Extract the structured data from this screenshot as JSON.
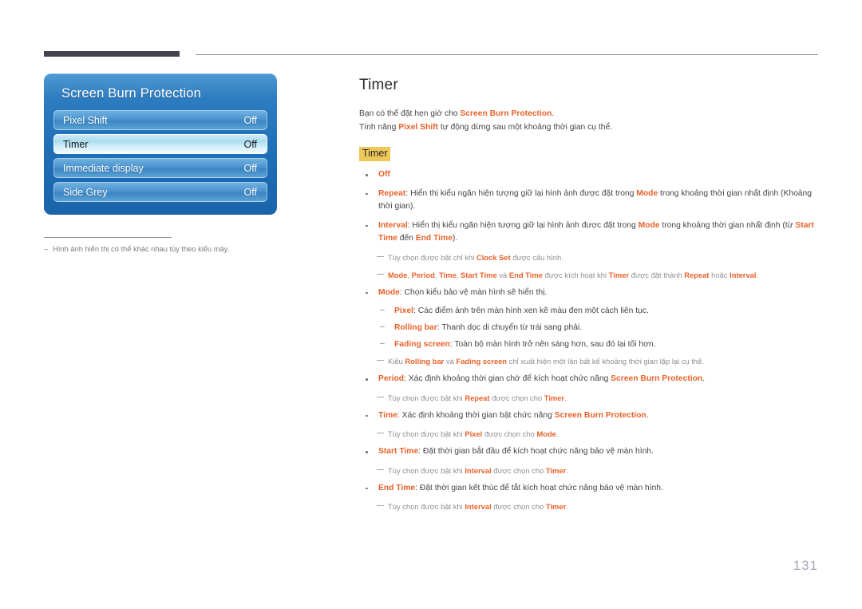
{
  "header": {
    "rule_thick_color": "#45424f",
    "rule_thin_color": "#8e8e96"
  },
  "osd": {
    "title": "Screen Burn Protection",
    "rows": [
      {
        "label": "Pixel Shift",
        "value": "Off",
        "selected": false
      },
      {
        "label": "Timer",
        "value": "Off",
        "selected": true
      },
      {
        "label": "Immediate display",
        "value": "Off",
        "selected": false
      },
      {
        "label": "Side Grey",
        "value": "Off",
        "selected": false
      }
    ],
    "footnote_dash": "‒",
    "footnote": "Hình ảnh hiển thị có thể khác nhau tùy theo kiểu máy."
  },
  "main": {
    "title": "Timer",
    "intro": [
      {
        "pre": "Bạn có thể đặt hẹn giờ cho ",
        "term": "Screen Burn Protection",
        "post": "."
      },
      {
        "pre": "Tính năng ",
        "term": "Pixel Shift",
        "post": " tự động dừng sau một khoảng thời gian cụ thể."
      }
    ],
    "section_heading": "Timer",
    "items": [
      {
        "kind": "bullet",
        "term": "Off",
        "text": ""
      },
      {
        "kind": "bullet",
        "term": "Repeat",
        "sep": ": ",
        "text_a": "Hiển thị kiểu ngăn hiện tượng giữ lại hình ảnh được đặt trong ",
        "term_b": "Mode",
        "text_b": " trong khoảng thời gian nhất định (Khoảng thời gian)."
      },
      {
        "kind": "bullet",
        "term": "Interval",
        "sep": ": ",
        "text_a": "Hiển thị kiểu ngăn hiện tượng giữ lại hình ảnh được đặt trong ",
        "term_b": "Mode",
        "text_b": " trong khoảng thời gian nhất định (từ ",
        "term_c": "Start Time",
        "text_c": " đến ",
        "term_d": "End Time",
        "text_d": ")."
      },
      {
        "kind": "note",
        "text_a": "Tùy chọn được bật chỉ khi ",
        "term_a": "Clock Set",
        "text_b": " được cấu hình."
      },
      {
        "kind": "note-multi",
        "term_a": "Mode",
        "sep_a": ", ",
        "term_b": "Period",
        "sep_b": ", ",
        "term_c": "Time",
        "sep_c": ", ",
        "term_d": "Start Time",
        "sep_d": " và ",
        "term_e": "End Time",
        "text_a": " được kích hoạt khi ",
        "term_f": "Timer",
        "text_b": " được đặt thành ",
        "term_g": "Repeat",
        "text_c": " hoặc ",
        "term_h": "Interval",
        "text_d": "."
      },
      {
        "kind": "bullet",
        "term": "Mode",
        "sep": ": ",
        "text_a": "Chọn kiểu bảo vệ màn hình sẽ hiển thị."
      },
      {
        "kind": "subdash",
        "term": "Pixel",
        "sep": ": ",
        "text_a": "Các điểm ảnh trên màn hình xen kẽ màu đen một cách liên tục."
      },
      {
        "kind": "subdash",
        "term": "Rolling bar",
        "sep": ": ",
        "text_a": "Thanh dọc di chuyển từ trái sang phải."
      },
      {
        "kind": "subdash",
        "term": "Fading screen",
        "sep": ": ",
        "text_a": "Toàn bộ màn hình trở nên sáng hơn, sau đó lại tối hơn."
      },
      {
        "kind": "note-rolling",
        "text_a": "Kiểu ",
        "term_a": "Rolling bar",
        "text_b": " và ",
        "term_b": "Fading screen",
        "text_c": " chỉ xuất hiện một lần bất kể khoảng thời gian lặp lại cụ thể."
      },
      {
        "kind": "bullet",
        "term": "Period",
        "sep": ": ",
        "text_a": "Xác định khoảng thời gian chờ để kích hoạt chức năng ",
        "term_b": "Screen Burn Protection",
        "text_b": "."
      },
      {
        "kind": "note",
        "text_a": "Tùy chọn được bật khi ",
        "term_a": "Repeat",
        "text_b": " được chọn cho ",
        "term_b": "Timer",
        "text_c": "."
      },
      {
        "kind": "bullet",
        "term": "Time",
        "sep": ": ",
        "text_a": "Xác định khoảng thời gian bật chức năng ",
        "term_b": "Screen Burn Protection",
        "text_b": "."
      },
      {
        "kind": "note",
        "text_a": "Tùy chọn được bật khi ",
        "term_a": "Pixel",
        "text_b": " được chọn cho ",
        "term_b": "Mode",
        "text_c": "."
      },
      {
        "kind": "bullet",
        "term": "Start Time",
        "sep": ": ",
        "text_a": "Đặt thời gian bắt đầu để kích hoạt chức năng bảo vệ màn hình."
      },
      {
        "kind": "note",
        "text_a": "Tùy chọn được bật khi ",
        "term_a": "Interval",
        "text_b": " được chọn cho ",
        "term_b": "Timer",
        "text_c": "."
      },
      {
        "kind": "bullet",
        "term": "End Time",
        "sep": ": ",
        "text_a": "Đặt thời gian kết thúc để tắt kích hoạt chức năng bảo vệ màn hình."
      },
      {
        "kind": "note",
        "text_a": "Tùy chọn được bật khi ",
        "term_a": "Interval",
        "text_b": " được chọn cho ",
        "term_b": "Timer",
        "text_c": "."
      }
    ]
  },
  "footer": {
    "page_number": "131"
  },
  "colors": {
    "accent_orange": "#e8622a",
    "highlight_yellow": "#edc758",
    "osd_blue": "#1f6fb7",
    "note_gray": "#8d8d96"
  }
}
